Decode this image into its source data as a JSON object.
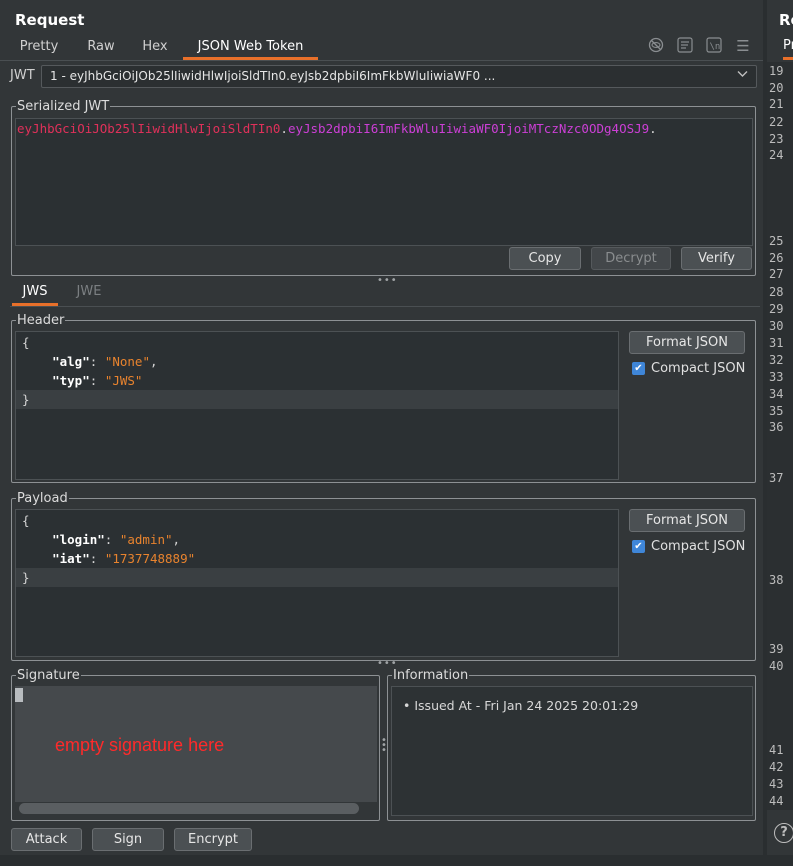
{
  "request": {
    "title": "Request",
    "tabs": [
      "Pretty",
      "Raw",
      "Hex",
      "JSON Web Token"
    ],
    "active_tab": "JSON Web Token",
    "toolbar_icons": [
      "hide-icon",
      "wrap-icon",
      "newline-icon",
      "menu-icon"
    ]
  },
  "jwt": {
    "label": "JWT",
    "selected": "1 - eyJhbGciOiJOb25lIiwidHlwIjoiSldTIn0.eyJsb2dpbiI6ImFkbWluIiwiaWF0 ..."
  },
  "serialized": {
    "legend": "Serialized JWT",
    "header_part": "eyJhbGciOiJOb25lIiwidHlwIjoiSldTIn0",
    "dot1": ".",
    "payload_part": "eyJsb2dpbiI6ImFkbWluIiwiaWF0IjoiMTczNzc0ODg4OSJ9",
    "dot2": ".",
    "buttons": {
      "copy": "Copy",
      "decrypt": "Decrypt",
      "verify": "Verify"
    }
  },
  "mode_tabs": {
    "jws": "JWS",
    "jwe": "JWE",
    "active": "JWS"
  },
  "header": {
    "legend": "Header",
    "open": "{",
    "close": "}",
    "fields": [
      {
        "key": "\"alg\"",
        "sep": ": ",
        "value": "\"None\"",
        "comma": ","
      },
      {
        "key": "\"typ\"",
        "sep": ": ",
        "value": "\"JWS\"",
        "comma": ""
      }
    ],
    "format_button": "Format JSON",
    "compact_label": "Compact JSON",
    "compact_checked": true
  },
  "payload": {
    "legend": "Payload",
    "open": "{",
    "close": "}",
    "fields": [
      {
        "key": "\"login\"",
        "sep": ": ",
        "value": "\"admin\"",
        "comma": ","
      },
      {
        "key": "\"iat\"",
        "sep": ": ",
        "value": "\"1737748889\"",
        "comma": ""
      }
    ],
    "format_button": "Format JSON",
    "compact_label": "Compact JSON",
    "compact_checked": true
  },
  "signature": {
    "legend": "Signature",
    "note": "empty signature here"
  },
  "information": {
    "legend": "Information",
    "items": [
      "Issued At - Fri Jan 24 2025 20:01:29"
    ]
  },
  "actions": {
    "attack": "Attack",
    "sign": "Sign",
    "encrypt": "Encrypt"
  },
  "response": {
    "title": "Response",
    "tab": "Pretty",
    "line_numbers": [
      "19",
      "20",
      "21",
      "22",
      "23",
      "24",
      "25",
      "26",
      "27",
      "28",
      "29",
      "30",
      "31",
      "32",
      "33",
      "34",
      "35",
      "36",
      "37",
      "38",
      "39",
      "40",
      "41",
      "42",
      "43",
      "44"
    ]
  },
  "help": "?"
}
